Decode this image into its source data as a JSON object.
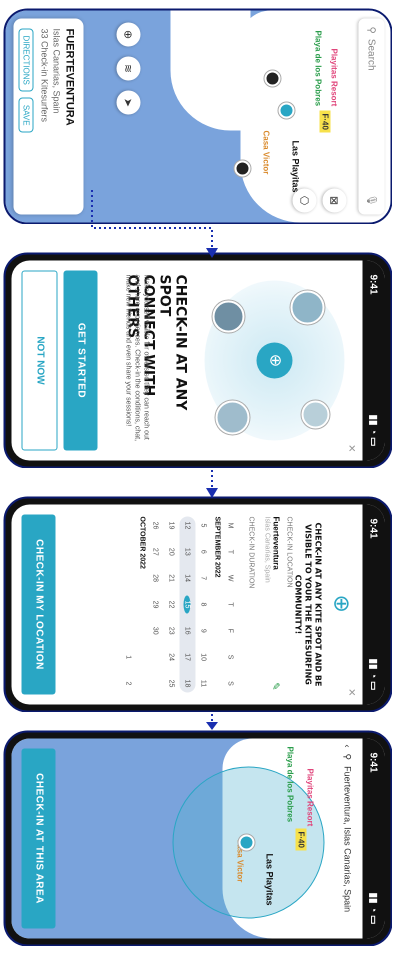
{
  "colors": {
    "accent": "#29a6c4",
    "sea": "#7aa3dc",
    "arrow": "#1a2fb0"
  },
  "panel1": {
    "search_placeholder": "Search",
    "pins": {
      "playitas_resort": "Playitas Resort",
      "playa_pobres": "Playa de los Pobres",
      "las_playitas": "Las Playitas",
      "casa_victor": "Casa Victor",
      "flag": "F·40"
    },
    "card": {
      "title": "FUERTEVENTURA",
      "subtitle": "Islas Canarias, Spain",
      "checkins": "33 Check-in Kitesurfers",
      "directions": "DIRECTIONS",
      "save": "SAVE"
    }
  },
  "panel2": {
    "time": "9:41",
    "title_line1": "CHECK-IN AT ANY SPOT",
    "title_line2": "CONNECT WITH OTHERS",
    "body": "Make yourself visible for others so they can reach out and share experiences. Check-in the conditions, chat, make new friends and even share your sessions!",
    "get_started": "GET STARTED",
    "not_now": "NOT NOW"
  },
  "panel3": {
    "time": "9:41",
    "title": "CHECK-IN AT ANY KITE SPOT AND BE VISIBLE TO YOUR THE KITESURFING COMMUNITY!",
    "location_label": "CHECK-IN LOCATION",
    "location_name": "Fuerteventura",
    "location_sub": "Islas Canarias, Spain",
    "duration_label": "CHECK-IN DURATION",
    "weekdays": [
      "M",
      "T",
      "W",
      "T",
      "F",
      "S",
      "S"
    ],
    "month1": "SEPTEMBER 2022",
    "sep_rows": [
      [
        "5",
        "6",
        "7",
        "8",
        "9",
        "10",
        "11"
      ],
      [
        "12",
        "13",
        "14",
        "15",
        "16",
        "17",
        "18"
      ],
      [
        "19",
        "20",
        "21",
        "22",
        "23",
        "24",
        "25"
      ],
      [
        "26",
        "27",
        "28",
        "29",
        "30",
        "",
        ""
      ]
    ],
    "month2": "OCTOBER 2022",
    "oct_rows": [
      [
        "",
        "",
        "",
        "",
        "",
        "1",
        "2"
      ]
    ],
    "cta": "CHECK-IN MY LOCATION"
  },
  "panel4": {
    "time": "9:41",
    "search_value": "Fuerteventura, Islas Canarias, Spain",
    "pins": {
      "playitas_resort": "Playitas Resort",
      "playa_pobres": "Playa de los Pobres",
      "las_playitas": "Las Playitas",
      "casa_victor": "Casa Victor",
      "flag": "F·40"
    },
    "cta": "CHECK-IN AT THIS AREA"
  }
}
